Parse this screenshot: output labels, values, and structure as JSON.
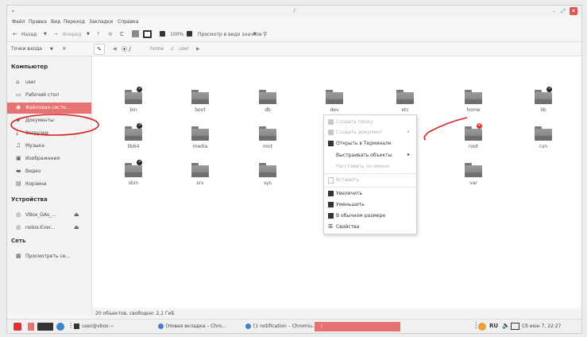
{
  "window": {
    "title": "/"
  },
  "menubar": {
    "items": [
      "Файл",
      "Правка",
      "Вид",
      "Переход",
      "Закладки",
      "Справка"
    ]
  },
  "toolbar": {
    "back_label": "Назад",
    "forward_label": "Вперед",
    "zoom": "100%",
    "view_mode": "Просмотр в виде значков"
  },
  "location": {
    "label": "Точки входа",
    "crumbs": [
      "home",
      "user"
    ]
  },
  "sidebar": {
    "computer_header": "Компьютер",
    "computer_items": [
      {
        "label": "user",
        "icon": "home-icon"
      },
      {
        "label": "Рабочий стол",
        "icon": "desktop-icon"
      },
      {
        "label": "Файловая систе...",
        "icon": "filesystem-icon",
        "selected": true
      },
      {
        "label": "Документы",
        "icon": "documents-icon"
      },
      {
        "label": "Загрузки",
        "icon": "downloads-icon"
      },
      {
        "label": "Музыка",
        "icon": "music-icon"
      },
      {
        "label": "Изображения",
        "icon": "images-icon"
      },
      {
        "label": "Видео",
        "icon": "video-icon"
      },
      {
        "label": "Корзина",
        "icon": "trash-icon"
      }
    ],
    "devices_header": "Устройства",
    "devices_items": [
      {
        "label": "VBox_GAs_...",
        "icon": "disc-icon"
      },
      {
        "label": "redos-Ever...",
        "icon": "disc-icon"
      }
    ],
    "network_header": "Сеть",
    "network_items": [
      {
        "label": "Просмотреть се...",
        "icon": "network-icon"
      }
    ]
  },
  "files": [
    {
      "name": "bin",
      "badge": "link"
    },
    {
      "name": "boot",
      "badge": ""
    },
    {
      "name": "db",
      "badge": ""
    },
    {
      "name": "dev",
      "badge": ""
    },
    {
      "name": "etc",
      "badge": ""
    },
    {
      "name": "home",
      "badge": "link"
    },
    {
      "name": "lib",
      "badge": "link"
    },
    {
      "name": "lib64",
      "badge": "link"
    },
    {
      "name": "media",
      "badge": ""
    },
    {
      "name": "mnt",
      "badge": ""
    },
    {
      "name": "",
      "badge": ""
    },
    {
      "name": "root",
      "badge": "locked"
    },
    {
      "name": "run",
      "badge": ""
    },
    {
      "name": "sbin",
      "badge": "link"
    },
    {
      "name": "srv",
      "badge": ""
    },
    {
      "name": "sys",
      "badge": ""
    },
    {
      "name": "",
      "badge": ""
    },
    {
      "name": "var",
      "badge": ""
    }
  ],
  "context_menu": {
    "items": [
      {
        "label": "Создать папку",
        "disabled": true,
        "submenu": false
      },
      {
        "label": "Создать документ",
        "disabled": true,
        "submenu": true
      },
      {
        "label": "Открыть в Терминале",
        "disabled": false,
        "submenu": false
      },
      {
        "label": "Выстраивать объекты",
        "disabled": false,
        "submenu": true
      },
      {
        "label": "Расставить по имени",
        "disabled": true,
        "submenu": false
      },
      {
        "label": "Вставить",
        "disabled": true,
        "submenu": false
      },
      {
        "label": "Увеличить",
        "disabled": false,
        "submenu": false
      },
      {
        "label": "Уменьшить",
        "disabled": false,
        "submenu": false
      },
      {
        "label": "В обычном размере",
        "disabled": false,
        "submenu": false
      },
      {
        "label": "Свойства",
        "disabled": false,
        "submenu": false
      }
    ]
  },
  "status": {
    "text": "20 объектов, свободно: 2,1 ГиБ"
  },
  "taskbar": {
    "apps": [
      {
        "label": "user@vbox:~"
      },
      {
        "label": "[Новая вкладка – Chro..."
      },
      {
        "label": "[1 notification – Chromiu..."
      },
      {
        "label": "/"
      }
    ],
    "language": "RU",
    "clock": "Сб июн 7, 22:27"
  },
  "colors": {
    "accent": "#e67272",
    "folder": "#8a8a8a",
    "annotation": "#d42020"
  }
}
